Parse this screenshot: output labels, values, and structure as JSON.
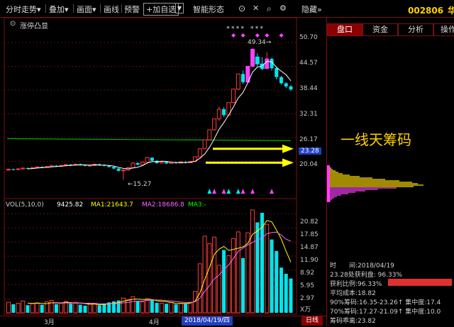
{
  "menu": {
    "items": [
      "分时走势",
      "叠加",
      "画面",
      "画线",
      "预警",
      "+加自选",
      "智能形态"
    ],
    "right_label": "隐藏"
  },
  "stock": {
    "code": "002806",
    "name": "华锋"
  },
  "chart": {
    "indicator_name": "涨停凸显",
    "price_axis": [
      "50.70",
      "44.57",
      "38.44",
      "32.31",
      "26.17",
      "23.28",
      "20.04"
    ],
    "peak_label": "49.34",
    "low_label": "15.27",
    "vol_header": {
      "name": "VOL(5,10,0)",
      "vol": "9425.82",
      "ma1": "MA1:21643.7",
      "ma2": "MA2:18686.8",
      "ma3": "MA3:-"
    },
    "vol_axis": [
      "20.82",
      "17.85",
      "14.87",
      "11.90",
      "8.92",
      "5.95",
      "2.97",
      "X万"
    ],
    "date_axis": {
      "m3": "3月",
      "m4": "4月",
      "selected": "2018/04/19/四",
      "period_button": "日线"
    }
  },
  "panel": {
    "tabs": [
      "盘口",
      "资金",
      "分析",
      "操作"
    ],
    "callout": "一线天筹码",
    "info": {
      "row1": "时　　间:2018/04/19",
      "row2": "23.28处获利盘: 96.33%",
      "row3_label": "获利比例:96.33%",
      "row4": "平均成本:18.82",
      "row5": "90%筹码:16.35-23.26↑ 集中度:17.4",
      "row6": "70%筹码:17.27-21.09↑ 集中度:10.0",
      "row7": "筹码乖离:23.82"
    }
  },
  "chart_data": {
    "type": "candlestick",
    "price_ylim": [
      15,
      52
    ],
    "marked_price": 23.28,
    "peak": 49.34,
    "low": 15.27,
    "candles": [
      {
        "o": 17.8,
        "c": 18.0,
        "h": 18.2,
        "l": 17.6
      },
      {
        "o": 18.0,
        "c": 17.9,
        "h": 18.2,
        "l": 17.7
      },
      {
        "o": 17.9,
        "c": 18.1,
        "h": 18.3,
        "l": 17.8
      },
      {
        "o": 18.1,
        "c": 18.3,
        "h": 18.5,
        "l": 17.9
      },
      {
        "o": 18.3,
        "c": 18.2,
        "h": 18.5,
        "l": 18.0
      },
      {
        "o": 18.2,
        "c": 18.4,
        "h": 18.6,
        "l": 18.1
      },
      {
        "o": 18.4,
        "c": 18.6,
        "h": 18.8,
        "l": 18.2
      },
      {
        "o": 18.6,
        "c": 18.5,
        "h": 18.8,
        "l": 18.3
      },
      {
        "o": 18.5,
        "c": 18.7,
        "h": 18.9,
        "l": 18.4
      },
      {
        "o": 18.7,
        "c": 18.9,
        "h": 19.1,
        "l": 18.6
      },
      {
        "o": 18.9,
        "c": 18.8,
        "h": 19.1,
        "l": 18.6
      },
      {
        "o": 18.8,
        "c": 19.0,
        "h": 19.2,
        "l": 18.7
      },
      {
        "o": 19.0,
        "c": 19.2,
        "h": 19.4,
        "l": 18.8
      },
      {
        "o": 19.2,
        "c": 19.1,
        "h": 19.4,
        "l": 18.9
      },
      {
        "o": 19.1,
        "c": 19.3,
        "h": 19.5,
        "l": 19.0
      },
      {
        "o": 19.3,
        "c": 19.1,
        "h": 19.5,
        "l": 18.9
      },
      {
        "o": 19.1,
        "c": 18.9,
        "h": 19.2,
        "l": 18.7
      },
      {
        "o": 18.9,
        "c": 19.0,
        "h": 19.2,
        "l": 18.7
      },
      {
        "o": 19.0,
        "c": 19.3,
        "h": 19.5,
        "l": 18.9
      },
      {
        "o": 19.3,
        "c": 19.1,
        "h": 19.5,
        "l": 18.9
      },
      {
        "o": 19.1,
        "c": 18.9,
        "h": 19.3,
        "l": 18.7
      },
      {
        "o": 18.9,
        "c": 18.6,
        "h": 19.0,
        "l": 18.4
      },
      {
        "o": 18.6,
        "c": 18.2,
        "h": 18.7,
        "l": 18.0
      },
      {
        "o": 18.2,
        "c": 17.6,
        "h": 18.3,
        "l": 17.4
      },
      {
        "o": 17.6,
        "c": 17.8,
        "h": 18.0,
        "l": 15.3
      },
      {
        "o": 17.8,
        "c": 18.4,
        "h": 18.6,
        "l": 17.6
      },
      {
        "o": 18.4,
        "c": 19.6,
        "h": 19.8,
        "l": 18.3
      },
      {
        "o": 19.6,
        "c": 19.2,
        "h": 19.8,
        "l": 19.0
      },
      {
        "o": 19.2,
        "c": 19.8,
        "h": 20.0,
        "l": 19.1
      },
      {
        "o": 19.8,
        "c": 21.0,
        "h": 21.2,
        "l": 19.7
      },
      {
        "o": 21.0,
        "c": 20.2,
        "h": 21.1,
        "l": 20.0
      },
      {
        "o": 20.2,
        "c": 19.6,
        "h": 20.3,
        "l": 19.4
      },
      {
        "o": 19.6,
        "c": 19.9,
        "h": 20.1,
        "l": 19.4
      },
      {
        "o": 19.9,
        "c": 19.5,
        "h": 20.0,
        "l": 19.3
      },
      {
        "o": 19.5,
        "c": 19.8,
        "h": 20.0,
        "l": 19.4
      },
      {
        "o": 19.8,
        "c": 19.6,
        "h": 20.0,
        "l": 19.4
      },
      {
        "o": 19.6,
        "c": 19.9,
        "h": 20.1,
        "l": 19.5
      },
      {
        "o": 19.9,
        "c": 19.7,
        "h": 20.1,
        "l": 19.5
      },
      {
        "o": 19.7,
        "c": 20.0,
        "h": 20.2,
        "l": 19.6
      },
      {
        "o": 20.0,
        "c": 21.2,
        "h": 21.3,
        "l": 19.9
      },
      {
        "o": 21.2,
        "c": 23.3,
        "h": 23.3,
        "l": 21.1
      },
      {
        "o": 23.3,
        "c": 25.6,
        "h": 25.6,
        "l": 23.2
      },
      {
        "o": 25.6,
        "c": 28.2,
        "h": 28.2,
        "l": 25.5
      },
      {
        "o": 28.2,
        "c": 31.0,
        "h": 31.0,
        "l": 28.0
      },
      {
        "o": 31.0,
        "c": 33.5,
        "h": 34.2,
        "l": 30.5
      },
      {
        "o": 33.5,
        "c": 32.0,
        "h": 34.0,
        "l": 31.5
      },
      {
        "o": 32.0,
        "c": 35.2,
        "h": 35.2,
        "l": 31.8
      },
      {
        "o": 35.2,
        "c": 38.7,
        "h": 38.7,
        "l": 35.0
      },
      {
        "o": 38.7,
        "c": 42.6,
        "h": 42.6,
        "l": 38.5
      },
      {
        "o": 42.6,
        "c": 40.5,
        "h": 43.5,
        "l": 40.0
      },
      {
        "o": 40.5,
        "c": 44.6,
        "h": 44.6,
        "l": 40.2
      },
      {
        "o": 44.6,
        "c": 49.0,
        "h": 49.3,
        "l": 44.3
      },
      {
        "o": 47.0,
        "c": 45.2,
        "h": 48.0,
        "l": 44.5
      },
      {
        "o": 45.2,
        "c": 44.0,
        "h": 47.0,
        "l": 43.6
      },
      {
        "o": 44.0,
        "c": 46.5,
        "h": 48.2,
        "l": 43.8
      },
      {
        "o": 46.5,
        "c": 44.1,
        "h": 46.8,
        "l": 43.5
      },
      {
        "o": 44.1,
        "c": 41.8,
        "h": 44.5,
        "l": 41.2
      },
      {
        "o": 41.8,
        "c": 40.2,
        "h": 42.1,
        "l": 39.9
      },
      {
        "o": 40.2,
        "c": 39.4,
        "h": 40.5,
        "l": 39.0
      },
      {
        "o": 39.4,
        "c": 38.6,
        "h": 39.8,
        "l": 38.2
      }
    ],
    "vol_ylim": [
      0,
      22.5
    ],
    "volumes": [
      2.2,
      1.8,
      2.0,
      2.5,
      1.6,
      1.9,
      2.1,
      1.7,
      2.3,
      2.6,
      1.8,
      2.0,
      2.4,
      1.9,
      2.2,
      1.7,
      1.5,
      1.8,
      2.0,
      1.6,
      1.9,
      2.2,
      2.4,
      2.6,
      3.1,
      2.8,
      3.4,
      2.5,
      2.3,
      3.0,
      2.7,
      2.1,
      2.0,
      1.9,
      2.2,
      1.8,
      2.0,
      1.9,
      2.2,
      4.5,
      10.3,
      16.1,
      14.5,
      15.9,
      10.0,
      13.2,
      12.0,
      15.6,
      17.0,
      11.5,
      16.8,
      21.6,
      19.0,
      21.0,
      18.6,
      15.4,
      13.0,
      9.5,
      8.2,
      7.2
    ]
  }
}
